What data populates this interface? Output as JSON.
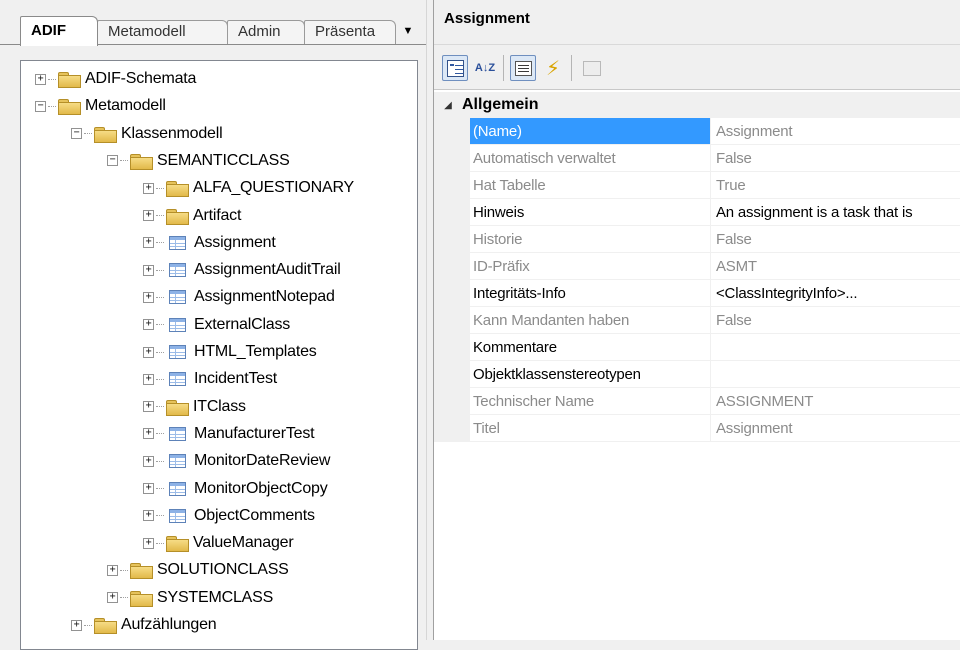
{
  "tabs": [
    {
      "label": "ADIF",
      "active": true
    },
    {
      "label": "Metamodell",
      "active": false
    },
    {
      "label": "Admin",
      "active": false
    },
    {
      "label": "Präsenta",
      "active": false
    }
  ],
  "tab_dropdown_glyph": "▼",
  "tree": {
    "items": [
      {
        "label": "ADIF-Schemata",
        "expander": "+",
        "icon": "folder-icon",
        "depth": 0
      },
      {
        "label": "Metamodell",
        "expander": "−",
        "icon": "folder-icon",
        "depth": 0
      },
      {
        "label": "Klassenmodell",
        "expander": "−",
        "icon": "folder-icon",
        "depth": 1
      },
      {
        "label": "SEMANTICCLASS",
        "expander": "−",
        "icon": "folder-icon",
        "depth": 2
      },
      {
        "label": "ALFA_QUESTIONARY",
        "expander": "+",
        "icon": "folder-icon",
        "depth": 3
      },
      {
        "label": "Artifact",
        "expander": "+",
        "icon": "folder-icon",
        "depth": 3
      },
      {
        "label": "Assignment",
        "expander": "+",
        "icon": "class-icon",
        "depth": 3
      },
      {
        "label": "AssignmentAuditTrail",
        "expander": "+",
        "icon": "class-icon",
        "depth": 3
      },
      {
        "label": "AssignmentNotepad",
        "expander": "+",
        "icon": "class-icon",
        "depth": 3
      },
      {
        "label": "ExternalClass",
        "expander": "+",
        "icon": "class-icon",
        "depth": 3
      },
      {
        "label": "HTML_Templates",
        "expander": "+",
        "icon": "class-icon",
        "depth": 3
      },
      {
        "label": "IncidentTest",
        "expander": "+",
        "icon": "class-icon",
        "depth": 3
      },
      {
        "label": "ITClass",
        "expander": "+",
        "icon": "folder-icon",
        "depth": 3
      },
      {
        "label": "ManufacturerTest",
        "expander": "+",
        "icon": "class-icon",
        "depth": 3
      },
      {
        "label": "MonitorDateReview",
        "expander": "+",
        "icon": "class-icon",
        "depth": 3
      },
      {
        "label": "MonitorObjectCopy",
        "expander": "+",
        "icon": "class-icon",
        "depth": 3
      },
      {
        "label": "ObjectComments",
        "expander": "+",
        "icon": "class-icon",
        "depth": 3
      },
      {
        "label": "ValueManager",
        "expander": "+",
        "icon": "folder-icon",
        "depth": 3
      },
      {
        "label": "SOLUTIONCLASS",
        "expander": "+",
        "icon": "folder-icon",
        "depth": 2
      },
      {
        "label": "SYSTEMCLASS",
        "expander": "+",
        "icon": "folder-icon",
        "depth": 2
      },
      {
        "label": "Aufzählungen",
        "expander": "+",
        "icon": "folder-icon",
        "depth": 1
      }
    ]
  },
  "properties": {
    "title": "Assignment",
    "toolbar": {
      "categorized_icon": "categorized-icon",
      "alphabetical_glyph": "A↓Z",
      "properties_icon": "properties-icon",
      "events_glyph": "⚡",
      "pages_icon": "property-pages-icon"
    },
    "category": {
      "label": "Allgemein",
      "toggle": "◢"
    },
    "rows": [
      {
        "name": "(Name)",
        "value": "Assignment",
        "readonly": true,
        "selected": true
      },
      {
        "name": "Automatisch verwaltet",
        "value": "False",
        "readonly": true,
        "selected": false
      },
      {
        "name": "Hat Tabelle",
        "value": "True",
        "readonly": true,
        "selected": false
      },
      {
        "name": "Hinweis",
        "value": "An assignment is a task that is",
        "readonly": false,
        "selected": false
      },
      {
        "name": "Historie",
        "value": "False",
        "readonly": true,
        "selected": false
      },
      {
        "name": "ID-Präfix",
        "value": "ASMT",
        "readonly": true,
        "selected": false
      },
      {
        "name": "Integritäts-Info",
        "value": "<ClassIntegrityInfo>...",
        "readonly": false,
        "selected": false
      },
      {
        "name": "Kann Mandanten haben",
        "value": "False",
        "readonly": true,
        "selected": false
      },
      {
        "name": "Kommentare",
        "value": "",
        "readonly": false,
        "selected": false
      },
      {
        "name": "Objektklassenstereotypen",
        "value": "",
        "readonly": false,
        "selected": false
      },
      {
        "name": "Technischer Name",
        "value": "ASSIGNMENT",
        "readonly": true,
        "selected": false
      },
      {
        "name": "Titel",
        "value": "Assignment",
        "readonly": true,
        "selected": false
      }
    ]
  }
}
